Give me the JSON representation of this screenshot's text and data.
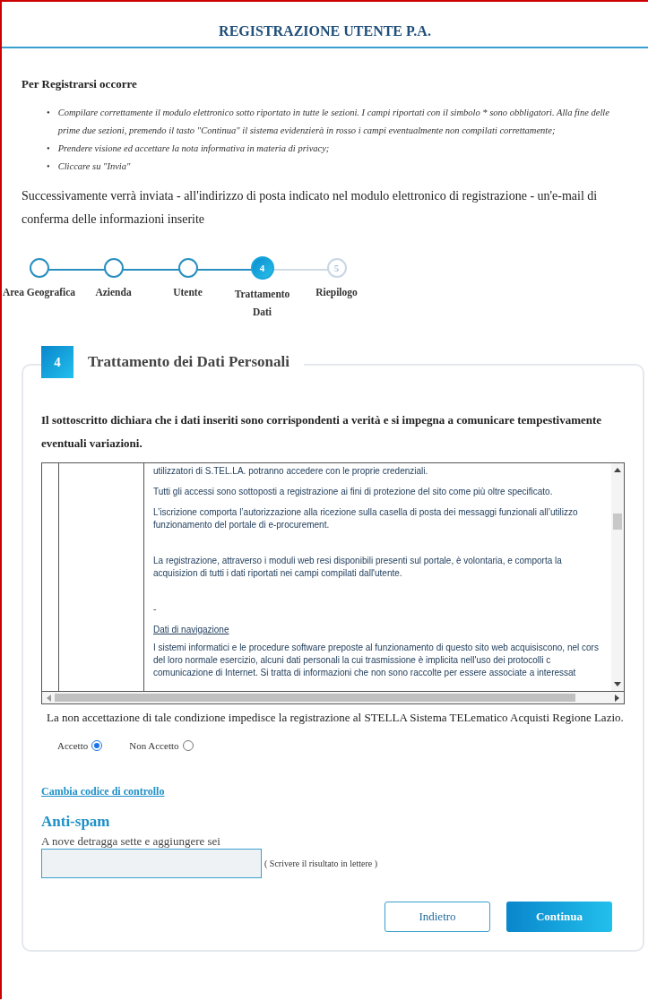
{
  "header": {
    "title": "REGISTRAZIONE UTENTE P.A."
  },
  "intro": {
    "heading": "Per Registrarsi occorre",
    "bullets": [
      {
        "marker": "•",
        "text": "Compilare correttamente il modulo elettronico sotto riportato in tutte le sezioni. I campi riportati con il simbolo * sono obbligatori. Alla fine delle prime due sezioni, premendo il tasto \"Continua\" il sistema evidenzierà in rosso i campi eventualmente non compilati correttamente;"
      },
      {
        "marker": "•",
        "text": "Prendere visione ed accettare la nota informativa in materia di privacy;"
      },
      {
        "marker": "•",
        "text": "Cliccare su \"Invia\""
      }
    ],
    "note": "Successivamente verrà inviata - all'indirizzo di posta indicato nel modulo elettronico di registrazione - un'e-mail di conferma delle informazioni inserite"
  },
  "stepper": [
    {
      "label": "Area Geografica",
      "kind": "done"
    },
    {
      "label": "Azienda",
      "kind": "done"
    },
    {
      "label": "Utente",
      "kind": "done"
    },
    {
      "label": "Trattamento Dati",
      "number": "4",
      "kind": "current"
    },
    {
      "label": "Riepilogo",
      "number": "5",
      "kind": "todo"
    }
  ],
  "section": {
    "number": "4",
    "title": "Trattamento dei Dati Personali",
    "declaration": "Il sottoscritto dichiara che i dati inseriti sono corrispondenti a verità e si impegna a comunicare tempestivamente eventuali variazioni.",
    "privacy_text": [
      {
        "kind": "text",
        "text": "utilizzatori di S.TEL.LA. potranno accedere con le proprie credenziali."
      },
      {
        "kind": "text",
        "text": "Tutti gli accessi sono sottoposti a registrazione ai fini di protezione del sito come più oltre specificato."
      },
      {
        "kind": "text",
        "text": "L’iscrizione comporta l’autorizzazione alla ricezione sulla casella di posta dei messaggi funzionali all’utilizzo funzionamento del portale di e-procurement."
      },
      {
        "kind": "spaced",
        "text": "La registrazione, attraverso i moduli web resi disponibili presenti sul portale, è volontaria, e comporta la acquisizion di tutti i dati riportati nei campi compilati dall'utente."
      },
      {
        "kind": "spaced",
        "text": "-"
      },
      {
        "kind": "underlined",
        "text": "Dati di navigazione"
      },
      {
        "kind": "text",
        "text": "I sistemi informatici e le procedure software preposte al funzionamento di questo sito web acquisiscono, nel cors del loro normale esercizio, alcuni dati personali la cui trasmissione è implicita nell'uso dei protocolli c comunicazione di Internet. Si tratta di informazioni che non sono raccolte per essere associate a interessat"
      }
    ],
    "refusal_note": "La non accettazione di tale condizione impedisce la registrazione al STELLA Sistema TELematico Acquisti Regione Lazio.",
    "consent": [
      {
        "label": "Accetto",
        "selected": true
      },
      {
        "label": "Non Accetto",
        "selected": false
      }
    ],
    "change_code_link": "Cambia codice di controllo",
    "antispam": {
      "title": "Anti-spam",
      "question": "A nove detragga sette e aggiungere sei",
      "hint": "( Scrivere il risultato in lettere )"
    },
    "buttons": [
      {
        "label": "Indietro",
        "kind": "secondary"
      },
      {
        "label": "Continua",
        "kind": "primary"
      }
    ]
  }
}
